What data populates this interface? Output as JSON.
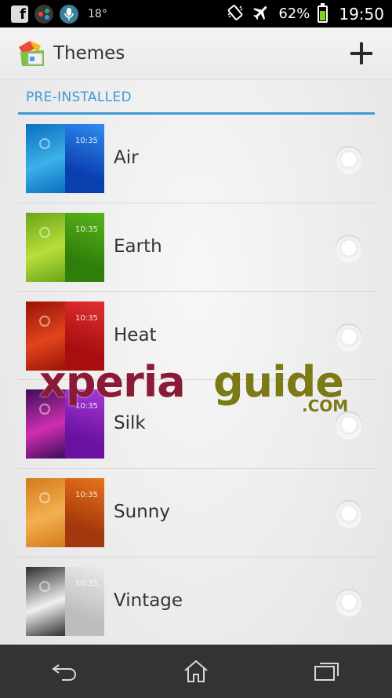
{
  "status_bar": {
    "temperature": "18°",
    "battery_percent": "62%",
    "time": "19:50",
    "battery_level": 0.62,
    "icons": [
      "facebook-icon",
      "notification-dots-icon",
      "microphone-icon",
      "vibrate-icon",
      "airplane-mode-icon",
      "battery-icon"
    ]
  },
  "action_bar": {
    "title": "Themes",
    "add_icon": "plus-icon"
  },
  "section": {
    "label": "PRE-INSTALLED"
  },
  "themes": [
    {
      "name": "Air",
      "clock": "10:35",
      "colors": [
        "#0b6fc0",
        "#3db0e8",
        "#0a3fb0",
        "#2f8df0"
      ]
    },
    {
      "name": "Earth",
      "clock": "10:35",
      "colors": [
        "#6aa518",
        "#b8df3a",
        "#2f7d0a",
        "#59b51c"
      ]
    },
    {
      "name": "Heat",
      "clock": "10:35",
      "colors": [
        "#9a1208",
        "#e0451c",
        "#a80d10",
        "#e23030"
      ]
    },
    {
      "name": "Silk",
      "clock": "10:35",
      "colors": [
        "#3d0d5a",
        "#d02eb0",
        "#6a11a0",
        "#a83ad6"
      ]
    },
    {
      "name": "Sunny",
      "clock": "10:35",
      "colors": [
        "#d47a1a",
        "#f3b050",
        "#a3380c",
        "#e8731c"
      ]
    },
    {
      "name": "Vintage",
      "clock": "10:35",
      "colors": [
        "#2d2d2d",
        "#f0f0f0",
        "#bdbdbd",
        "#eaeaea"
      ]
    }
  ],
  "watermark": {
    "text_left": "xperia",
    "text_right": "guide",
    "domain": ".COM"
  },
  "accent_color": "#3c9ad6"
}
